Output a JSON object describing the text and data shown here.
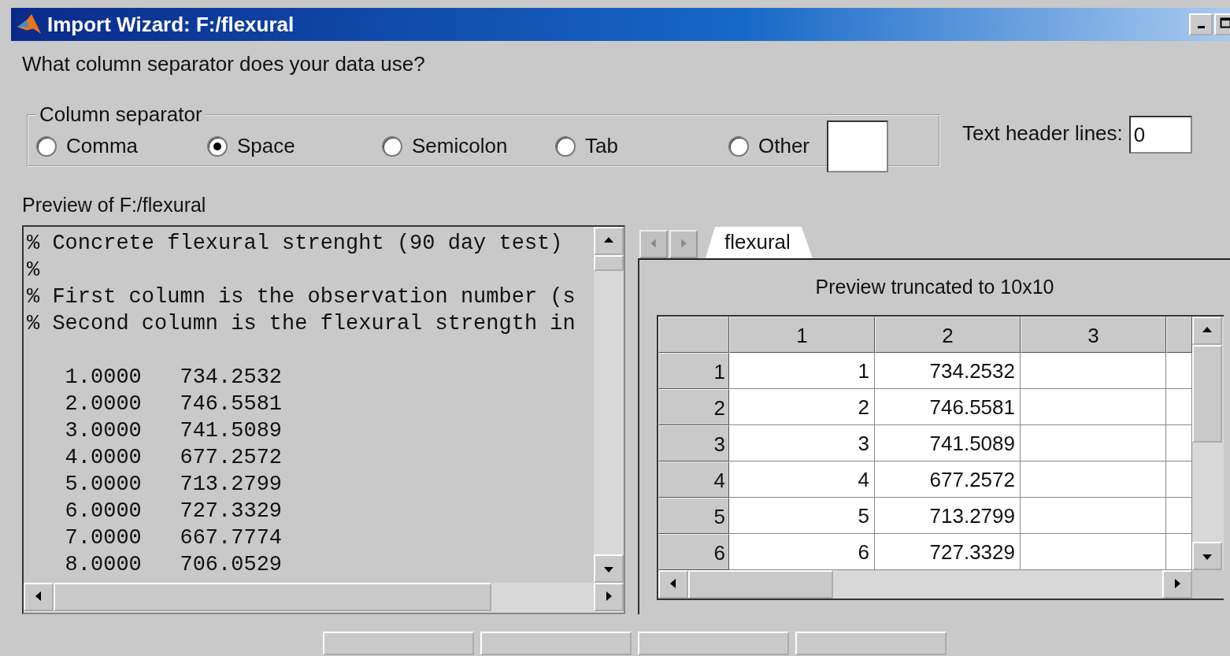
{
  "window": {
    "title": "Import Wizard: F:/flexural"
  },
  "prompt": "What column separator does your data use?",
  "separator_group": {
    "title": "Column separator",
    "options": [
      {
        "label": "Comma",
        "selected": false,
        "kind": "radio"
      },
      {
        "label": "Space",
        "selected": true,
        "kind": "radio"
      },
      {
        "label": "Semicolon",
        "selected": false,
        "kind": "radio"
      },
      {
        "label": "Tab",
        "selected": false,
        "kind": "radio"
      },
      {
        "label": "Other",
        "selected": false,
        "kind": "other"
      }
    ]
  },
  "header_lines": {
    "label": "Text header lines:",
    "value": "0"
  },
  "preview": {
    "title": "Preview of F:/flexural",
    "comment_lines": [
      "% Concrete flexural strenght (90 day test)",
      "%",
      "% First column is the observation number (s",
      "% Second column is the flexural strength in"
    ],
    "data_lines": [
      "   1.0000   734.2532",
      "   2.0000   746.5581",
      "   3.0000   741.5089",
      "   4.0000   677.2572",
      "   5.0000   713.2799",
      "   6.0000   727.3329",
      "   7.0000   667.7774",
      "   8.0000   706.0529"
    ]
  },
  "sheet": {
    "tabs": [
      {
        "label": "flexural",
        "selected": true
      }
    ],
    "note": "Preview truncated to 10x10",
    "columns": [
      "1",
      "2",
      "3"
    ],
    "rows": [
      {
        "header": "1",
        "cells": [
          "1",
          "734.2532"
        ]
      },
      {
        "header": "2",
        "cells": [
          "2",
          "746.5581"
        ]
      },
      {
        "header": "3",
        "cells": [
          "3",
          "741.5089"
        ]
      },
      {
        "header": "4",
        "cells": [
          "4",
          "677.2572"
        ]
      },
      {
        "header": "5",
        "cells": [
          "5",
          "713.2799"
        ]
      },
      {
        "header": "6",
        "cells": [
          "6",
          "727.3329"
        ]
      }
    ]
  }
}
